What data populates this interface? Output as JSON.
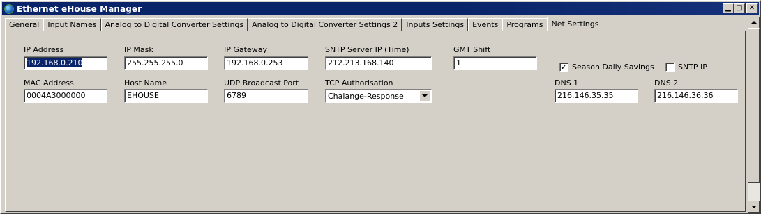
{
  "window": {
    "title": "Ethernet eHouse Manager",
    "buttons": {
      "minimize": "▁",
      "maximize": "□",
      "close": "✕"
    }
  },
  "tabs": [
    {
      "label": "General"
    },
    {
      "label": "Input Names"
    },
    {
      "label": "Analog to Digital Converter Settings"
    },
    {
      "label": "Analog to Digital Converter Settings 2"
    },
    {
      "label": "Inputs Settings"
    },
    {
      "label": "Events"
    },
    {
      "label": "Programs"
    },
    {
      "label": "Net Settings",
      "active": true
    }
  ],
  "net": {
    "ip_address": {
      "label": "IP Address",
      "value": "192.168.0.210"
    },
    "ip_mask": {
      "label": "IP Mask",
      "value": "255.255.255.0"
    },
    "ip_gateway": {
      "label": "IP Gateway",
      "value": "192.168.0.253"
    },
    "sntp_server": {
      "label": "SNTP Server IP (Time)",
      "value": "212.213.168.140"
    },
    "gmt_shift": {
      "label": "GMT Shift",
      "value": "1"
    },
    "season_daily_savings": {
      "label": "Season Daily Savings",
      "checked": true,
      "mark": "✓"
    },
    "sntp_ip": {
      "label": "SNTP IP",
      "checked": false
    },
    "mac_address": {
      "label": "MAC Address",
      "value": "0004A3000000"
    },
    "host_name": {
      "label": "Host Name",
      "value": "EHOUSE"
    },
    "udp_port": {
      "label": "UDP Broadcast Port",
      "value": "6789"
    },
    "tcp_auth": {
      "label": "TCP Authorisation",
      "value": "Chalange-Response"
    },
    "dns1": {
      "label": "DNS 1",
      "value": "216.146.35.35"
    },
    "dns2": {
      "label": "DNS 2",
      "value": "216.146.36.36"
    }
  },
  "icons": {
    "app": "globe-icon",
    "combo": "chevron-down-icon",
    "scroll_up": "arrow-up-icon",
    "scroll_down": "arrow-down-icon"
  },
  "colors": {
    "title_bar": "#0a246a",
    "face": "#d4d0c8",
    "selection": "#0a246a"
  }
}
